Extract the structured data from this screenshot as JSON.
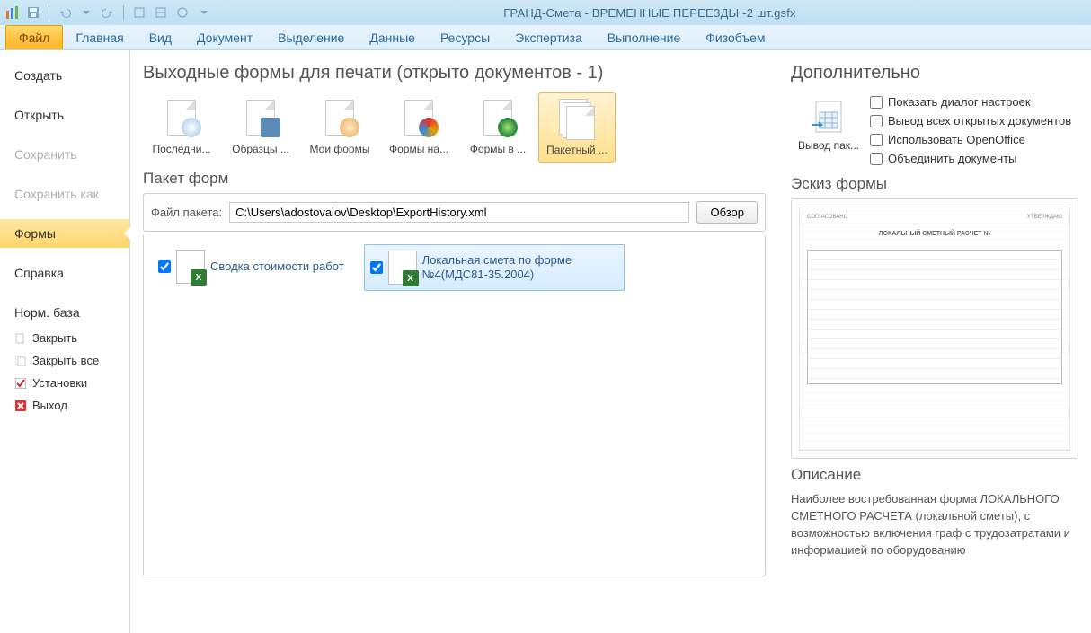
{
  "window": {
    "title": "ГРАНД-Смета - ВРЕМЕННЫЕ ПЕРЕЕЗДЫ -2 шт.gsfx"
  },
  "ribbon": {
    "file": "Файл",
    "tabs": [
      "Главная",
      "Вид",
      "Документ",
      "Выделение",
      "Данные",
      "Ресурсы",
      "Экспертиза",
      "Выполнение",
      "Физобъем"
    ]
  },
  "sidebar": {
    "create": "Создать",
    "open": "Открыть",
    "save": "Сохранить",
    "save_as": "Сохранить как",
    "forms": "Формы",
    "help": "Справка",
    "normbase": "Норм. база",
    "close": "Закрыть",
    "close_all": "Закрыть все",
    "settings": "Установки",
    "exit": "Выход"
  },
  "main": {
    "heading": "Выходные формы для печати (открыто документов - 1)",
    "icons": {
      "recent": "Последни...",
      "samples": "Образцы ...",
      "myforms": "Мои формы",
      "forms_on": "Формы на...",
      "forms_in": "Формы в ...",
      "batch": "Пакетный ..."
    },
    "pack": {
      "title": "Пакет форм",
      "file_label": "Файл пакета:",
      "path": "C:\\Users\\adostovalov\\Desktop\\ExportHistory.xml",
      "browse": "Обзор"
    },
    "forms": {
      "item1": "Сводка стоимости работ",
      "item2": "Локальная смета по форме №4(МДС81-35.2004)"
    }
  },
  "side": {
    "heading": "Дополнительно",
    "exportbtn": "Вывод пак...",
    "opts": {
      "show_dialog": "Показать диалог настроек",
      "all_open": "Вывод всех открытых документов",
      "openoffice": "Использовать OpenOffice",
      "merge": "Объединить документы"
    },
    "sketch": "Эскиз формы",
    "preview": {
      "left": "СОГЛАСОВАНО",
      "right": "УТВЕРЖДАЮ",
      "doc_title": "ЛОКАЛЬНЫЙ СМЕТНЫЙ РАСЧЕТ №"
    },
    "desc_h": "Описание",
    "desc_t": "Наиболее востребованная форма ЛОКАЛЬНОГО СМЕТНОГО РАСЧЕТА (локальной сметы), с возможностью включения граф с трудозатратами и информацией по оборудованию"
  }
}
